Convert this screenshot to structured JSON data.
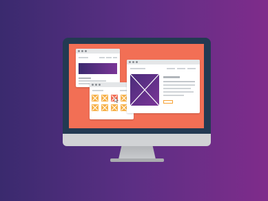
{
  "illustration": {
    "subject": "desktop-monitor-with-browser-windows",
    "colors": {
      "background_left": "#3a2a6e",
      "background_right": "#7f2c8b",
      "bezel": "#233a52",
      "screen": "#f26f55",
      "chin": "#d1d3d5",
      "stand": "#b3b5b8",
      "window": "#ffffff",
      "titlebar": "#e4e6e8",
      "placeholder_purple": "#6b3290",
      "tile_orange": "#f7b24a",
      "accent_orange": "#f7a233"
    },
    "icons": {
      "window_dots": "traffic-dots-icon",
      "image_placeholder": "image-placeholder-icon",
      "cursor": "cursor-icon"
    }
  }
}
